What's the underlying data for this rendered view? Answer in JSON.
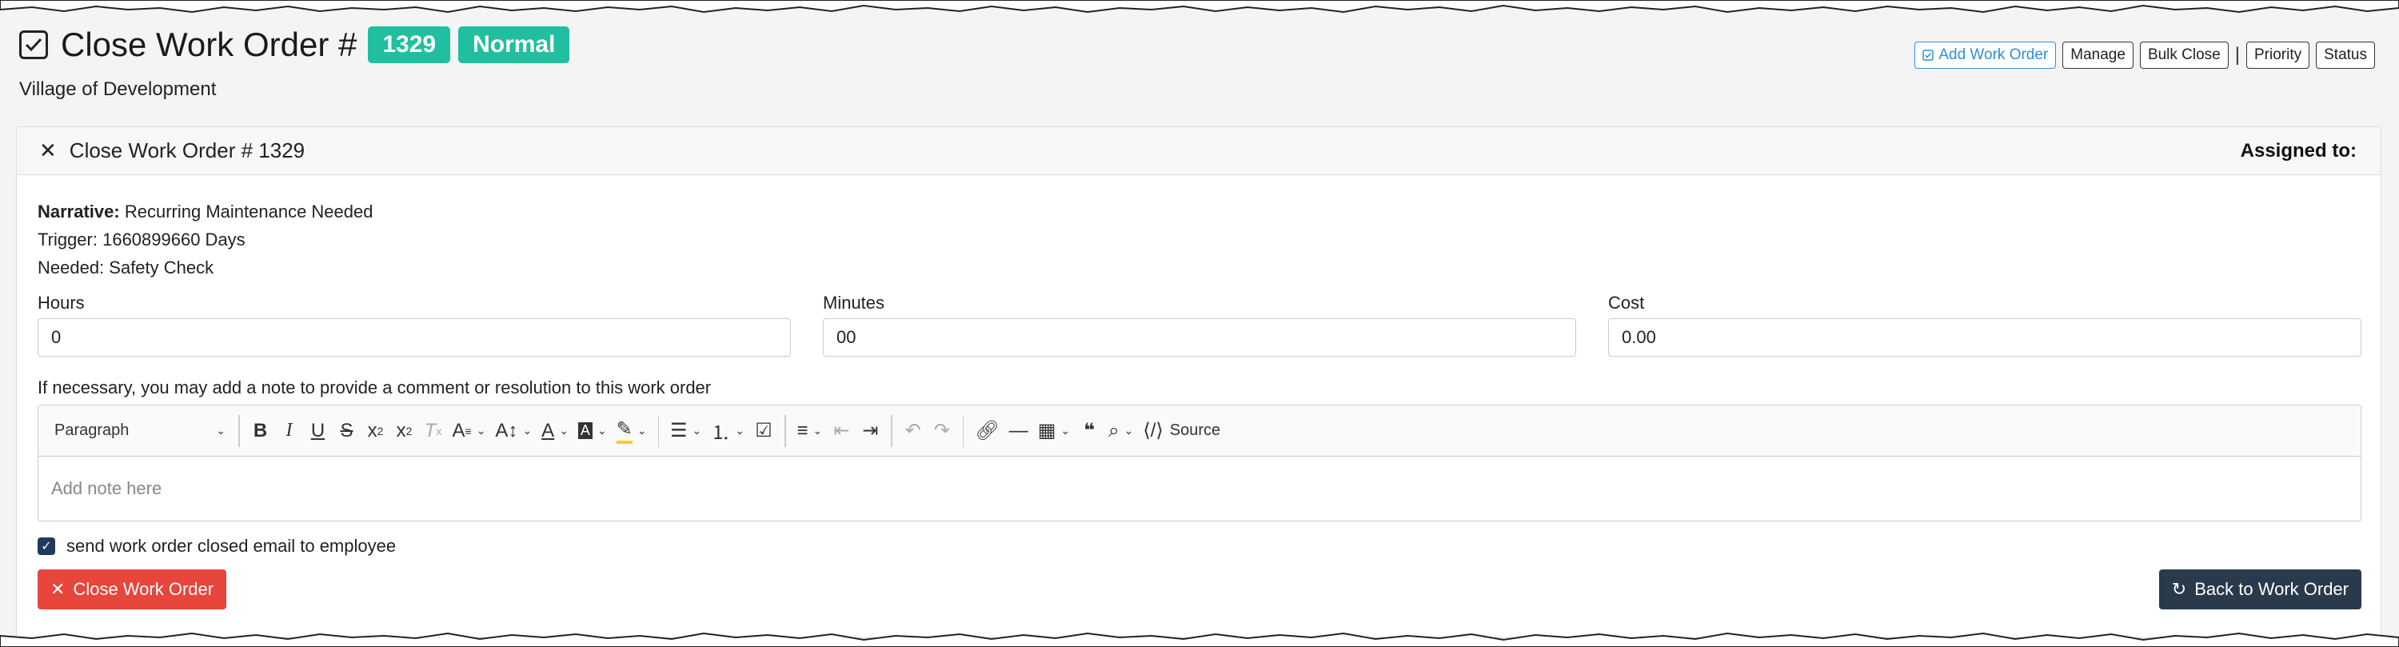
{
  "header": {
    "title": "Close Work Order #",
    "order_number": "1329",
    "priority_badge": "Normal",
    "organization": "Village of Development"
  },
  "top_toolbar": {
    "add_work_order": "Add Work Order",
    "manage": "Manage",
    "bulk_close": "Bulk Close",
    "separator": "|",
    "priority": "Priority",
    "status": "Status"
  },
  "panel": {
    "title": "Close Work Order # 1329",
    "assigned_to_label": "Assigned to:"
  },
  "details": {
    "narrative_label": "Narrative:",
    "narrative_value": "Recurring Maintenance Needed",
    "trigger": "Trigger: 1660899660 Days",
    "needed": "Needed: Safety Check"
  },
  "fields": {
    "hours_label": "Hours",
    "hours_value": "0",
    "minutes_label": "Minutes",
    "minutes_value": "00",
    "cost_label": "Cost",
    "cost_value": "0.00"
  },
  "note": {
    "label": "If necessary, you may add a note to provide a comment or resolution to this work order",
    "paragraph_style": "Paragraph",
    "placeholder": "Add note here",
    "source_label": "Source"
  },
  "email": {
    "checked": true,
    "label": "send work order closed email to employee"
  },
  "actions": {
    "close_label": "Close Work Order",
    "back_label": "Back to Work Order"
  },
  "colors": {
    "badge": "#1fbf9f",
    "primary_link": "#2d8fd5",
    "danger": "#e8453c",
    "dark": "#2a3a4d"
  }
}
